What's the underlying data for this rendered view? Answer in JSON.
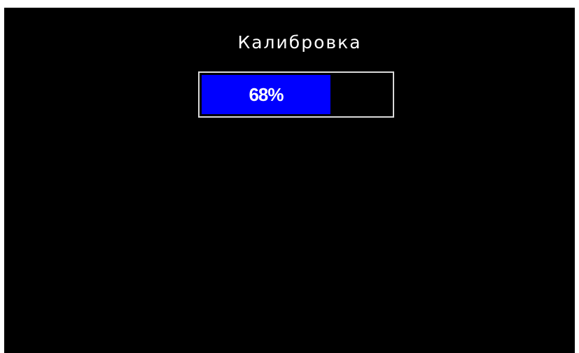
{
  "screen": {
    "title": "Калибровка",
    "progress": {
      "label": "68%",
      "value": 0.68
    }
  },
  "colors": {
    "background": "#000000",
    "text": "#ffffff",
    "progress_fill": "#0000ff",
    "progress_border": "#d9d9d9"
  }
}
